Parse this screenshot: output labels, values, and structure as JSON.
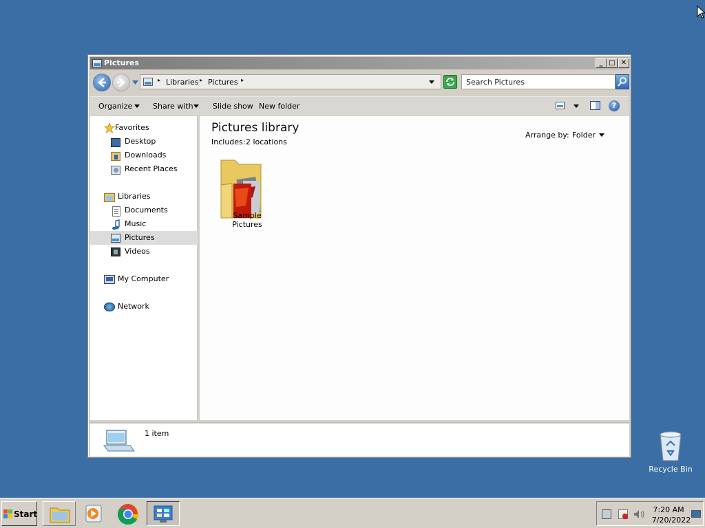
{
  "window": {
    "title": "Pictures",
    "minimize": "_",
    "maximize": "□",
    "close": "✕"
  },
  "address": {
    "crumbs": [
      "Libraries",
      "Pictures"
    ],
    "search_placeholder": "Search Pictures"
  },
  "toolbar": {
    "organize": "Organize",
    "share_with": "Share with",
    "slide_show": "Slide show",
    "new_folder": "New folder"
  },
  "nav": {
    "favorites": "Favorites",
    "desktop": "Desktop",
    "downloads": "Downloads",
    "recent_places": "Recent Places",
    "libraries": "Libraries",
    "documents": "Documents",
    "music": "Music",
    "pictures": "Pictures",
    "videos": "Videos",
    "my_computer": "My Computer",
    "network": "Network"
  },
  "content": {
    "library_title": "Pictures library",
    "includes_label": "Includes:",
    "includes_link": "2 locations",
    "arrange_label": "Arrange by:",
    "arrange_value": "Folder",
    "folder_name": "Sample Pictures"
  },
  "status": {
    "count": "1 item"
  },
  "desktop": {
    "recycle_bin": "Recycle Bin"
  },
  "taskbar": {
    "start": "Start",
    "time": "7:20 AM",
    "date": "7/20/2022"
  },
  "colors": {
    "desktop": "#3a6ea5",
    "title_gradient_start": "#7a7a7a",
    "selected": "#dcdcdc"
  }
}
